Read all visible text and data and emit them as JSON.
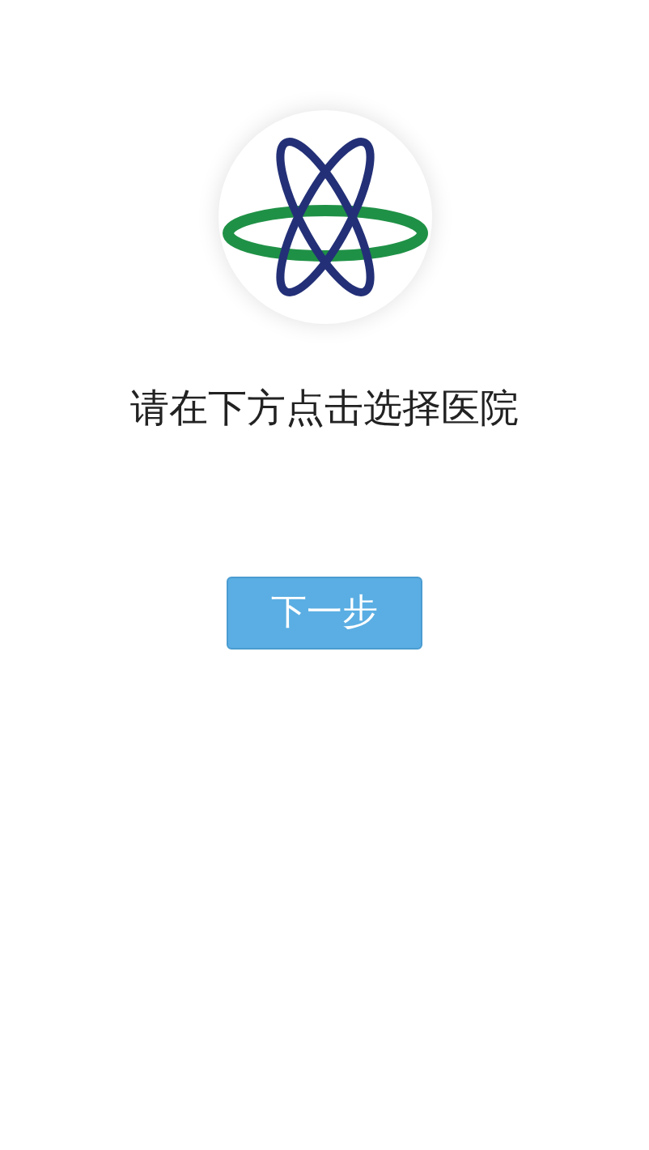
{
  "prompt": "请在下方点击选择医院",
  "next_button": {
    "label": "下一步"
  }
}
